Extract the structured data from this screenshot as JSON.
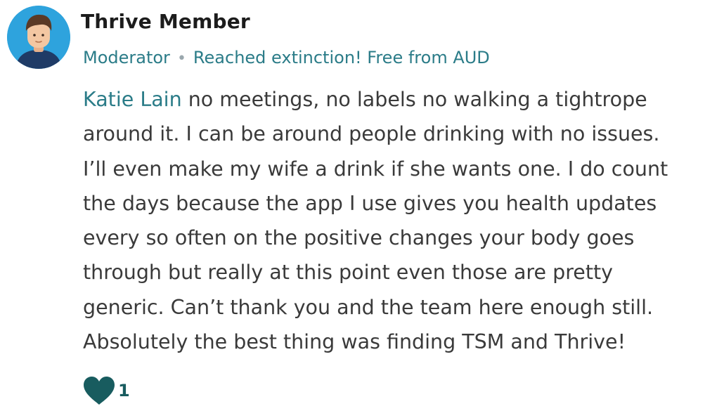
{
  "comment": {
    "author": "Thrive Member",
    "role": "Moderator",
    "badge": "Reached extinction! Free from AUD",
    "mention": "Katie Lain",
    "lines": [
      " no meetings, no labels no walking a tightrope",
      "around it. I can be around people drinking with no issues.",
      "I’ll even make my wife a drink if she wants one. I do count",
      "the days because the app I use gives you health updates",
      "every so often on the positive changes your body goes",
      "through but really at this point even those are pretty",
      "generic. Can’t thank you and the team here enough still.",
      "Absolutely the best thing was finding TSM and Thrive!"
    ],
    "like_count": "1"
  },
  "icons": {
    "avatar": "avatar-person-icon",
    "like": "heart-icon",
    "separator": "dot-separator"
  },
  "colors": {
    "avatar_bg": "#2ea3dd",
    "accent": "#2b7c88",
    "heart": "#185c5f",
    "text": "#3a3a3a"
  }
}
